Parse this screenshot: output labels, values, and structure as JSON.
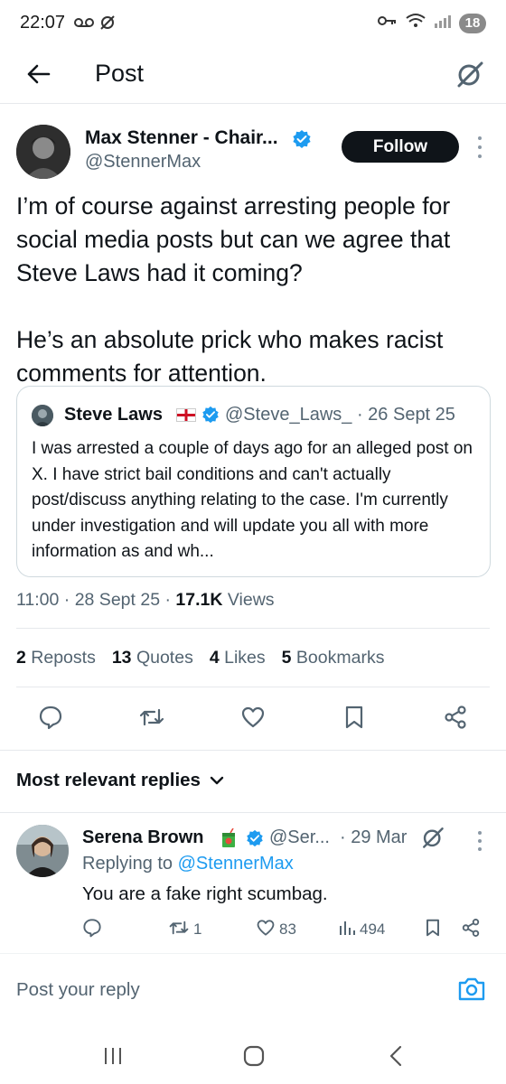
{
  "status": {
    "time": "22:07",
    "battery": "18"
  },
  "header": {
    "title": "Post"
  },
  "post": {
    "author_name": "Max Stenner - Chair...",
    "author_handle": "@StennerMax",
    "follow_label": "Follow",
    "body": "I’m of course against arresting people for social media posts but can we agree that Steve Laws had it coming?\n\nHe’s an absolute prick who makes racist comments for attention.",
    "time": "11:00",
    "date": "28 Sept 25",
    "views_count": "17.1K",
    "views_label": "Views"
  },
  "quote": {
    "name": "Steve Laws",
    "handle": "@Steve_Laws_",
    "date": "26 Sept 25",
    "text": "I was arrested a couple of days ago for an alleged post on X. I have strict bail conditions and can't actually post/discuss anything relating to the case. I'm currently under investigation and will update you all with more information as and wh..."
  },
  "stats": {
    "reposts_count": "2",
    "reposts_label": "Reposts",
    "quotes_count": "13",
    "quotes_label": "Quotes",
    "likes_count": "4",
    "likes_label": "Likes",
    "bookmarks_count": "5",
    "bookmarks_label": "Bookmarks"
  },
  "replies_section": {
    "sort_label": "Most relevant replies"
  },
  "reply": {
    "name": "Serena Brown",
    "handle": "@Ser...",
    "time": "29 Mar",
    "replying_prefix": "Replying to",
    "replying_handle": "@StennerMax",
    "text": "You are a fake right scumbag.",
    "retweets": "1",
    "likes": "83",
    "views": "494"
  },
  "composer": {
    "placeholder": "Post your reply"
  },
  "icons": {
    "verified_color": "#1d9bf0",
    "accent_color": "#1d9bf0"
  }
}
